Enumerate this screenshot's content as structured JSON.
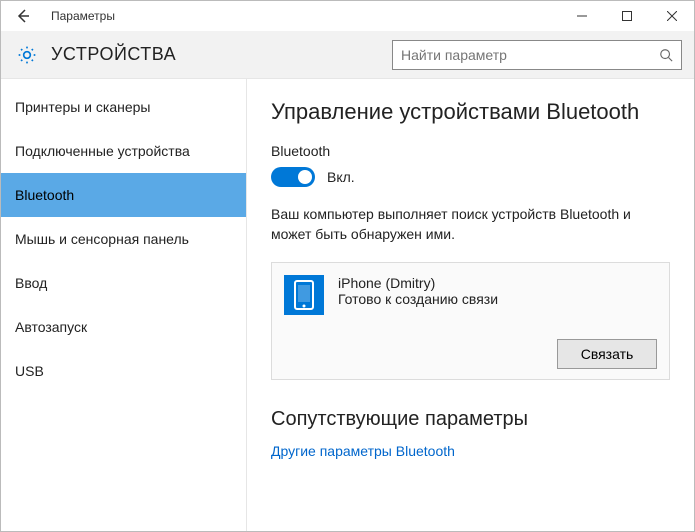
{
  "window": {
    "title": "Параметры"
  },
  "header": {
    "title": "УСТРОЙСТВА",
    "search_placeholder": "Найти параметр"
  },
  "sidebar": {
    "items": [
      {
        "label": "Принтеры и сканеры"
      },
      {
        "label": "Подключенные устройства"
      },
      {
        "label": "Bluetooth"
      },
      {
        "label": "Мышь и сенсорная панель"
      },
      {
        "label": "Ввод"
      },
      {
        "label": "Автозапуск"
      },
      {
        "label": "USB"
      }
    ],
    "active_index": 2
  },
  "main": {
    "heading": "Управление устройствами Bluetooth",
    "bt_label": "Bluetooth",
    "toggle_state_label": "Вкл.",
    "description": "Ваш компьютер выполняет поиск устройств Bluetooth и может быть обнаружен ими.",
    "device": {
      "name": "iPhone (Dmitry)",
      "status": "Готово к созданию связи",
      "pair_btn": "Связать"
    },
    "related_heading": "Сопутствующие параметры",
    "related_link": "Другие параметры Bluetooth"
  }
}
